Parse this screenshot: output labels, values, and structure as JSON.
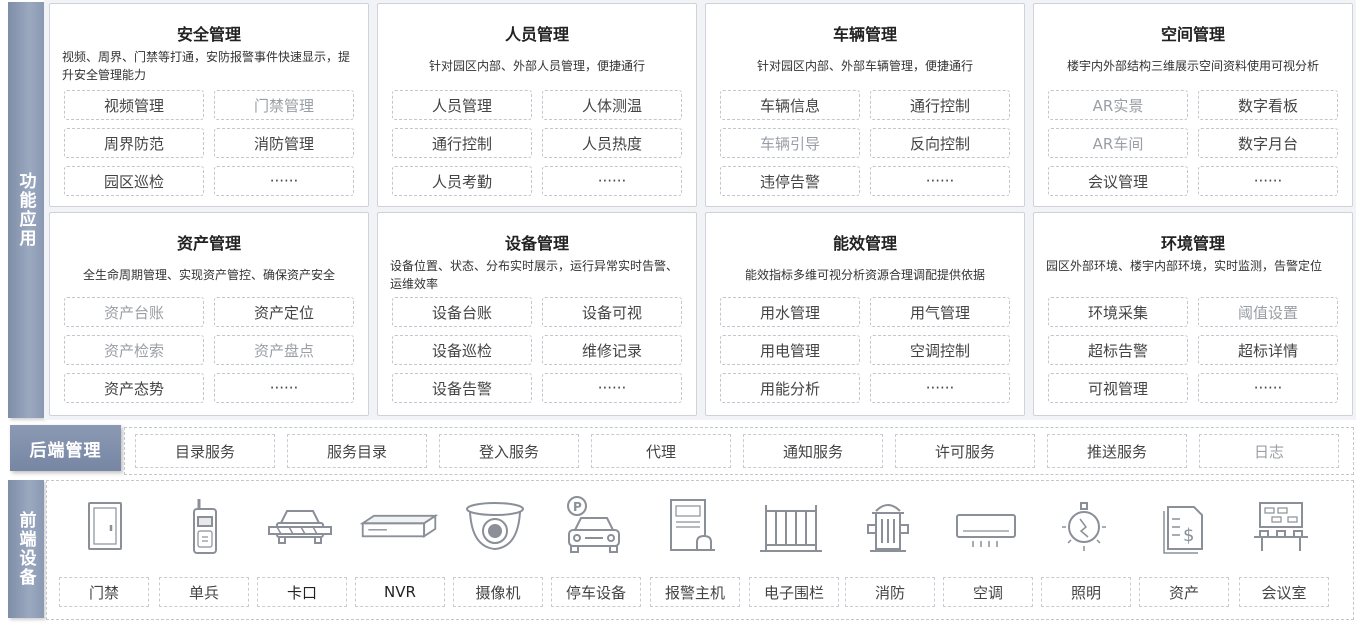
{
  "side_labels": {
    "functions": "功能应用",
    "backend": "后端管理",
    "frontend": "前端设备"
  },
  "modules": [
    {
      "title": "安全管理",
      "desc": "视频、周界、门禁等打通，安防报警事件快速显示，提升安全管理能力",
      "items": [
        "视频管理",
        "门禁管理",
        "周界防范",
        "消防管理",
        "园区巡检",
        "······"
      ]
    },
    {
      "title": "人员管理",
      "desc": "针对园区内部、外部人员管理，便捷通行",
      "items": [
        "人员管理",
        "人体测温",
        "通行控制",
        "人员热度",
        "人员考勤",
        "······"
      ]
    },
    {
      "title": "车辆管理",
      "desc": "针对园区内部、外部车辆管理，便捷通行",
      "items": [
        "车辆信息",
        "通行控制",
        "车辆引导",
        "反向控制",
        "违停告警",
        "······"
      ]
    },
    {
      "title": "空间管理",
      "desc": "楼宇内外部结构三维展示空间资料使用可视分析",
      "items": [
        "AR实景",
        "数字看板",
        "AR车间",
        "数字月台",
        "会议管理",
        "······"
      ]
    },
    {
      "title": "资产管理",
      "desc": "全生命周期管理、实现资产管控、确保资产安全",
      "items": [
        "资产台账",
        "资产定位",
        "资产检索",
        "资产盘点",
        "资产态势",
        "······"
      ]
    },
    {
      "title": "设备管理",
      "desc": "设备位置、状态、分布实时展示，运行异常实时告警、运维效率",
      "items": [
        "设备台账",
        "设备可视",
        "设备巡检",
        "维修记录",
        "设备告警",
        "······"
      ]
    },
    {
      "title": "能效管理",
      "desc": "能效指标多维可视分析资源合理调配提供依据",
      "items": [
        "用水管理",
        "用气管理",
        "用电管理",
        "空调控制",
        "用能分析",
        "······"
      ]
    },
    {
      "title": "环境管理",
      "desc": "园区外部环境、楼宇内部环境，实时监测，告警定位",
      "items": [
        "环境采集",
        "阈值设置",
        "超标告警",
        "超标详情",
        "可视管理",
        "······"
      ]
    }
  ],
  "backend_services": [
    "目录服务",
    "服务目录",
    "登入服务",
    "代理",
    "通知服务",
    "许可服务",
    "推送服务",
    "日志"
  ],
  "devices": [
    {
      "label": "门禁",
      "icon": "door-icon"
    },
    {
      "label": "单兵",
      "icon": "walkie-talkie-icon"
    },
    {
      "label": "卡口",
      "icon": "barrier-gate-icon"
    },
    {
      "label": "NVR",
      "icon": "nvr-icon"
    },
    {
      "label": "摄像机",
      "icon": "dome-camera-icon"
    },
    {
      "label": "停车设备",
      "icon": "parking-car-icon"
    },
    {
      "label": "报警主机",
      "icon": "alarm-host-icon"
    },
    {
      "label": "电子围栏",
      "icon": "fence-icon"
    },
    {
      "label": "消防",
      "icon": "fire-hydrant-icon"
    },
    {
      "label": "空调",
      "icon": "air-conditioner-icon"
    },
    {
      "label": "照明",
      "icon": "light-bulb-icon"
    },
    {
      "label": "资产",
      "icon": "asset-document-icon"
    },
    {
      "label": "会议室",
      "icon": "meeting-room-icon"
    }
  ]
}
